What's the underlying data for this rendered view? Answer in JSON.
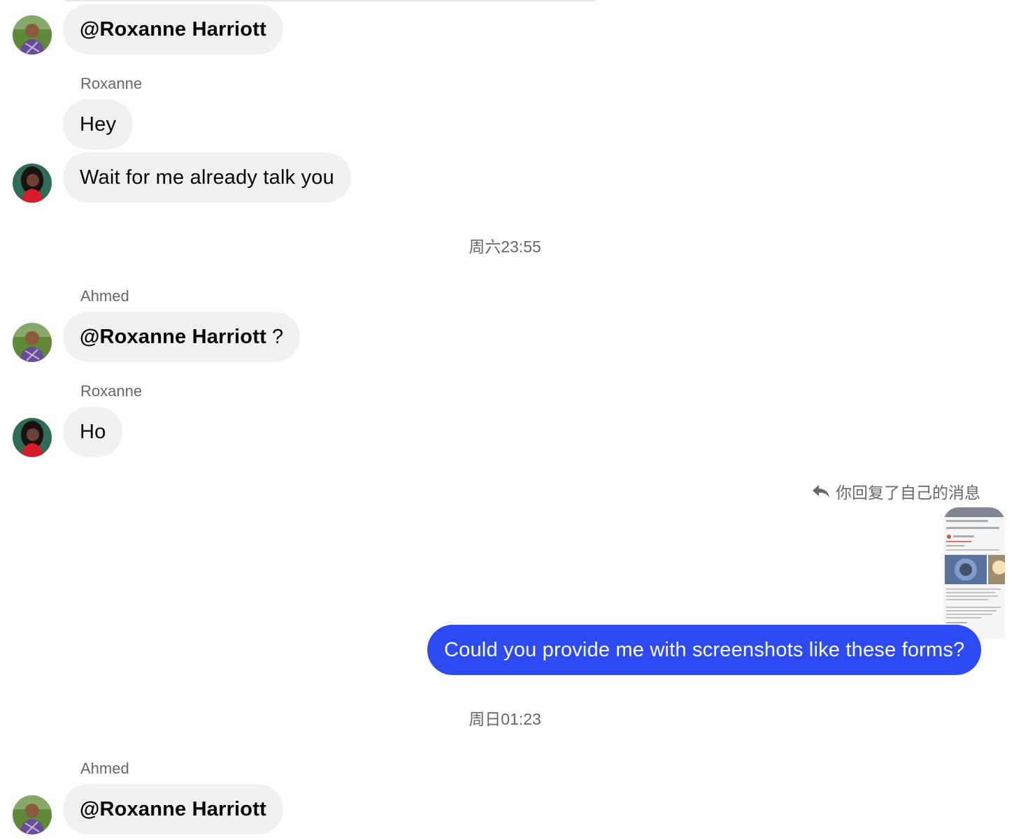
{
  "conversation": {
    "participants": {
      "ahmed": {
        "name": "Ahmed"
      },
      "roxanne": {
        "name": "Roxanne"
      }
    },
    "messages": [
      {
        "sender": "",
        "mention": "@Roxanne Harriott",
        "text": ""
      },
      {
        "sender": "Roxanne",
        "text": "Hey"
      },
      {
        "sender": "",
        "text": "Wait for me already talk you"
      },
      {
        "timestamp": "周六23:55"
      },
      {
        "sender": "Ahmed",
        "mention": "@Roxanne Harriott",
        "text": "?"
      },
      {
        "sender": "Roxanne",
        "text": "Ho"
      },
      {
        "reply_note": "你回复了自己的消息",
        "outgoing_text": "Could you provide me with screenshots like these forms?"
      },
      {
        "timestamp": "周日01:23"
      },
      {
        "sender": "Ahmed",
        "mention": "@Roxanne Harriott",
        "text": ""
      }
    ]
  },
  "colors": {
    "incoming_bubble": "#f0f0f0",
    "outgoing_bubble": "#2c4bf5",
    "meta_text": "#65676b"
  },
  "icons": {
    "reply": "reply-arrow-icon"
  }
}
